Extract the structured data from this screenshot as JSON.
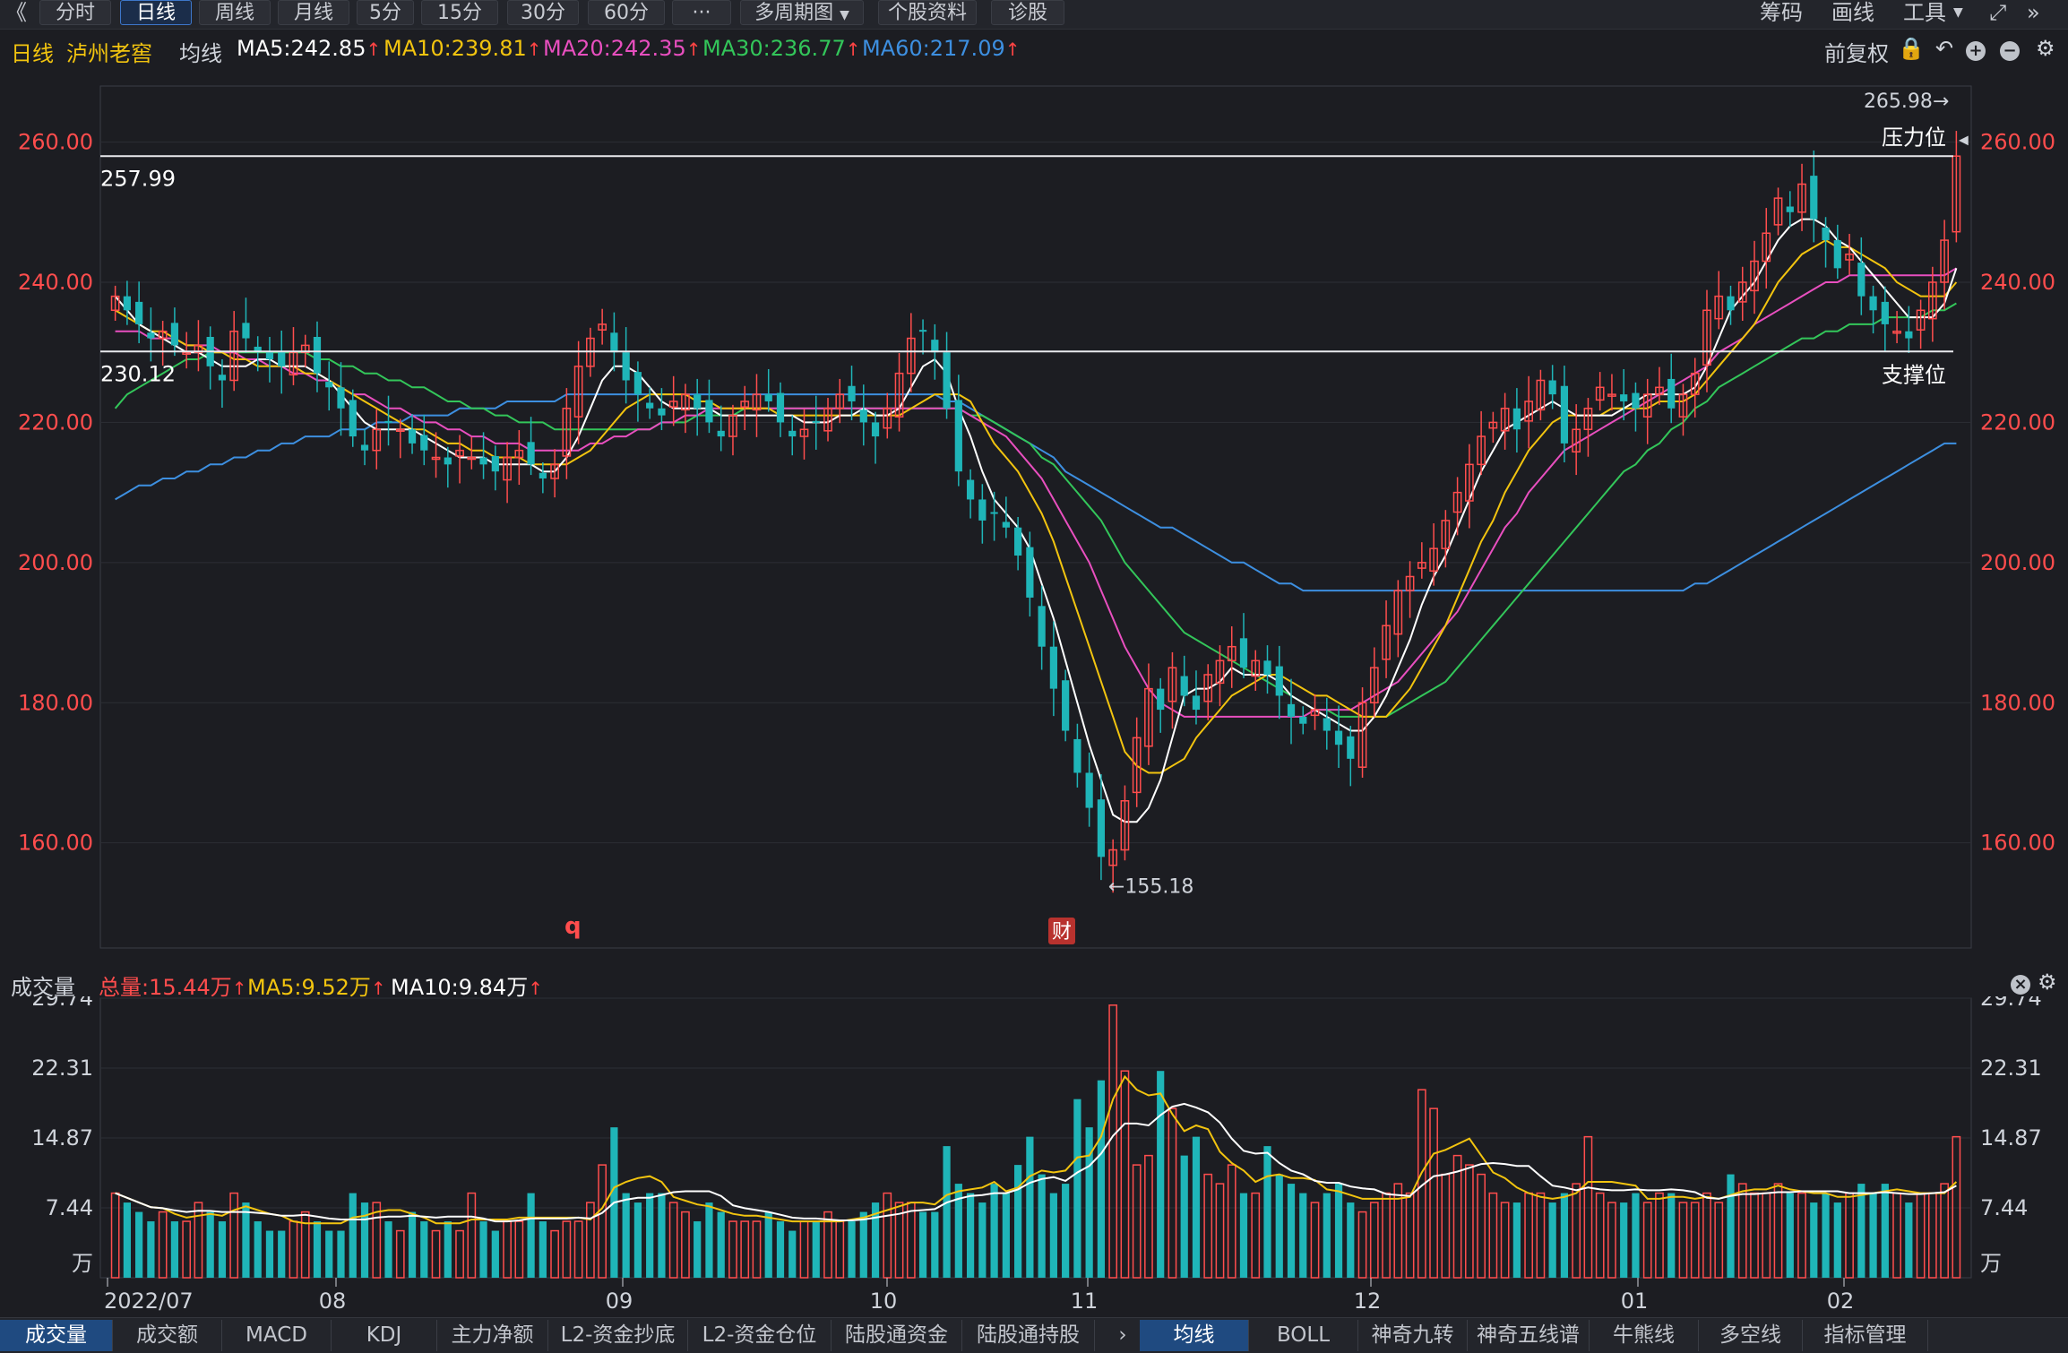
{
  "toolbar": {
    "back_glyph": "《",
    "periods": [
      "分时",
      "日线",
      "周线",
      "月线",
      "5分",
      "15分",
      "30分",
      "60分",
      "···"
    ],
    "active_period": "日线",
    "multi_period": "多周期图",
    "stock_info": "个股资料",
    "diagnose": "诊股",
    "right_items": [
      "筹码",
      "画线",
      "工具"
    ],
    "fullscreen_icon": "fullscreen-icon",
    "collapse_icon": "double-chevron-right-icon"
  },
  "info": {
    "period_label": "日线",
    "stock_name": "泸州老窖",
    "ma_label": "均线",
    "ma5": "MA5:242.85",
    "ma10": "MA10:239.81",
    "ma20": "MA20:242.35",
    "ma30": "MA30:236.77",
    "ma60": "MA60:217.09",
    "adjust": "前复权"
  },
  "price_panel": {
    "ticks": [
      "260.00",
      "240.00",
      "220.00",
      "200.00",
      "180.00",
      "160.00"
    ],
    "resistance_value": "257.99",
    "support_value": "230.12",
    "resistance_label": "压力位",
    "support_label": "支撑位",
    "high_marker": "265.98→",
    "low_marker": "←155.18",
    "q_marker": "q",
    "fin_marker": "财"
  },
  "volume_panel": {
    "label": "成交量",
    "total": "总量:15.44万",
    "ma5": "MA5:9.52万",
    "ma10": "MA10:9.84万",
    "ticks": [
      "29.74",
      "22.31",
      "14.87",
      "7.44"
    ],
    "unit": "万"
  },
  "x_axis": [
    "2022/07",
    "08",
    "09",
    "10",
    "11",
    "12",
    "01",
    "02"
  ],
  "bottom_tabs_left": [
    "成交量",
    "成交额",
    "MACD",
    "KDJ",
    "主力净额",
    "L2-资金抄底",
    "L2-资金仓位",
    "陆股通资金",
    "陆股通持股"
  ],
  "bottom_tabs_right": [
    "均线",
    "BOLL",
    "神奇九转",
    "神奇五线谱",
    "牛熊线",
    "多空线",
    "指标管理"
  ],
  "colors": {
    "up": "#ff4d4d",
    "down": "#1fb5b8",
    "ma5": "#ffffff",
    "ma10": "#f2c40f",
    "ma20": "#e84fbf",
    "ma30": "#33c65a",
    "ma60": "#3d8fe0",
    "bg": "#1c1d22"
  },
  "chart_data": {
    "type": "candlestick",
    "title": "泸州老窖 日线",
    "y_range": [
      145,
      268
    ],
    "resistance": 257.99,
    "support": 230.12,
    "high": 265.98,
    "low": 155.18,
    "close_series": [
      238,
      236,
      234,
      232,
      233,
      231,
      230,
      231,
      228,
      226,
      233,
      232,
      230,
      229,
      228,
      230,
      231,
      227,
      225,
      222,
      218,
      216,
      219,
      220,
      219,
      217,
      216,
      215,
      214,
      216,
      215,
      214,
      213,
      215,
      216,
      214,
      212,
      214,
      222,
      228,
      232,
      234,
      230,
      226,
      224,
      222,
      221,
      223,
      224,
      222,
      220,
      218,
      221,
      223,
      224,
      223,
      220,
      218,
      219,
      220,
      222,
      224,
      223,
      220,
      218,
      222,
      227,
      232,
      233,
      230,
      222,
      213,
      209,
      206,
      207,
      205,
      201,
      195,
      188,
      182,
      176,
      170,
      165,
      158,
      159,
      166,
      175,
      182,
      179,
      185,
      181,
      179,
      184,
      186,
      188,
      185,
      186,
      184,
      181,
      178,
      177,
      179,
      176,
      174,
      172,
      180,
      185,
      191,
      196,
      198,
      200,
      202,
      206,
      210,
      214,
      218,
      220,
      222,
      219,
      223,
      226,
      224,
      217,
      219,
      222,
      225,
      224,
      223,
      222,
      224,
      225,
      222,
      224,
      227,
      236,
      238,
      236,
      240,
      243,
      247,
      252,
      250,
      254,
      249,
      246,
      242,
      244,
      238,
      236,
      234,
      233,
      232,
      236,
      240,
      246,
      258
    ],
    "ma5_series": [
      238,
      236,
      234,
      233,
      232,
      231,
      230,
      230,
      229,
      228,
      228,
      228,
      229,
      229,
      228,
      228,
      228,
      227,
      226,
      224,
      222,
      220,
      219,
      219,
      219,
      219,
      218,
      217,
      216,
      215,
      215,
      215,
      214,
      214,
      214,
      214,
      213,
      213,
      215,
      218,
      222,
      226,
      228,
      228,
      227,
      225,
      223,
      222,
      222,
      222,
      222,
      221,
      221,
      221,
      221,
      221,
      221,
      221,
      220,
      220,
      220,
      221,
      221,
      222,
      221,
      221,
      222,
      225,
      228,
      229,
      227,
      222,
      218,
      213,
      209,
      207,
      205,
      202,
      197,
      192,
      186,
      180,
      174,
      169,
      164,
      163,
      163,
      165,
      169,
      175,
      181,
      182,
      182,
      183,
      185,
      184,
      184,
      184,
      183,
      181,
      180,
      179,
      178,
      177,
      176,
      176,
      178,
      181,
      185,
      189,
      194,
      198,
      201,
      205,
      209,
      213,
      216,
      219,
      220,
      221,
      222,
      223,
      222,
      221,
      221,
      221,
      221,
      222,
      223,
      224,
      224,
      224,
      224,
      225,
      228,
      232,
      236,
      238,
      240,
      243,
      246,
      248,
      249,
      249,
      248,
      246,
      245,
      243,
      241,
      239,
      237,
      235,
      235,
      235,
      237,
      242
    ],
    "ma10_series": [
      236,
      235,
      234,
      233,
      233,
      232,
      231,
      231,
      230,
      230,
      229,
      229,
      228,
      228,
      228,
      228,
      227,
      227,
      226,
      225,
      224,
      223,
      222,
      221,
      220,
      219,
      219,
      218,
      217,
      217,
      216,
      216,
      215,
      215,
      215,
      214,
      214,
      214,
      214,
      215,
      216,
      218,
      220,
      222,
      223,
      224,
      224,
      224,
      224,
      223,
      223,
      222,
      222,
      222,
      222,
      222,
      221,
      221,
      221,
      221,
      221,
      221,
      221,
      221,
      221,
      221,
      221,
      222,
      223,
      224,
      224,
      224,
      223,
      220,
      217,
      215,
      213,
      210,
      207,
      203,
      198,
      193,
      188,
      183,
      178,
      173,
      171,
      170,
      170,
      171,
      172,
      175,
      177,
      179,
      181,
      182,
      183,
      184,
      184,
      183,
      182,
      181,
      181,
      180,
      179,
      178,
      178,
      178,
      180,
      182,
      185,
      188,
      191,
      195,
      199,
      203,
      206,
      210,
      213,
      216,
      218,
      220,
      221,
      221,
      221,
      221,
      222,
      222,
      222,
      222,
      223,
      223,
      223,
      224,
      226,
      228,
      230,
      232,
      234,
      237,
      240,
      242,
      244,
      245,
      246,
      245,
      245,
      244,
      243,
      242,
      240,
      239,
      238,
      238,
      238,
      240
    ],
    "ma20_series": [
      233,
      233,
      233,
      232,
      232,
      232,
      231,
      231,
      231,
      230,
      230,
      229,
      229,
      228,
      228,
      227,
      227,
      226,
      226,
      225,
      224,
      224,
      223,
      222,
      222,
      221,
      220,
      220,
      219,
      219,
      218,
      218,
      217,
      217,
      217,
      216,
      216,
      216,
      216,
      216,
      217,
      217,
      218,
      218,
      219,
      219,
      220,
      220,
      221,
      221,
      222,
      222,
      222,
      222,
      222,
      222,
      222,
      222,
      222,
      222,
      222,
      222,
      222,
      222,
      222,
      222,
      222,
      222,
      222,
      222,
      222,
      222,
      221,
      220,
      219,
      218,
      216,
      214,
      212,
      209,
      206,
      203,
      200,
      196,
      192,
      188,
      185,
      182,
      180,
      179,
      178,
      178,
      178,
      178,
      178,
      178,
      178,
      178,
      178,
      178,
      178,
      179,
      179,
      179,
      179,
      180,
      181,
      182,
      183,
      185,
      187,
      189,
      191,
      193,
      196,
      199,
      202,
      205,
      207,
      210,
      212,
      214,
      216,
      217,
      218,
      219,
      220,
      221,
      222,
      223,
      224,
      225,
      226,
      227,
      228,
      230,
      231,
      232,
      234,
      235,
      236,
      237,
      238,
      239,
      240,
      240,
      241,
      241,
      241,
      241,
      241,
      241,
      241,
      241,
      241,
      242
    ],
    "ma30_series": [
      222,
      224,
      225,
      226,
      227,
      228,
      229,
      229,
      230,
      230,
      230,
      230,
      230,
      230,
      230,
      230,
      230,
      229,
      229,
      228,
      228,
      227,
      227,
      226,
      226,
      225,
      225,
      224,
      223,
      223,
      222,
      222,
      221,
      221,
      220,
      220,
      220,
      219,
      219,
      219,
      219,
      219,
      219,
      219,
      219,
      219,
      220,
      220,
      220,
      221,
      221,
      221,
      221,
      222,
      222,
      222,
      222,
      222,
      222,
      222,
      222,
      222,
      222,
      222,
      222,
      222,
      222,
      222,
      222,
      222,
      222,
      222,
      221,
      221,
      220,
      219,
      218,
      217,
      215,
      214,
      212,
      210,
      208,
      206,
      203,
      200,
      198,
      196,
      194,
      192,
      190,
      189,
      188,
      187,
      186,
      185,
      184,
      183,
      182,
      181,
      180,
      179,
      179,
      178,
      178,
      178,
      178,
      178,
      179,
      180,
      181,
      182,
      183,
      185,
      187,
      189,
      191,
      193,
      195,
      197,
      199,
      201,
      203,
      205,
      207,
      209,
      211,
      213,
      214,
      216,
      217,
      219,
      220,
      222,
      223,
      225,
      226,
      227,
      228,
      229,
      230,
      231,
      232,
      232,
      233,
      233,
      234,
      234,
      234,
      235,
      235,
      235,
      235,
      236,
      236,
      237
    ],
    "ma60_series": [
      209,
      210,
      211,
      211,
      212,
      212,
      213,
      213,
      214,
      214,
      215,
      215,
      216,
      216,
      217,
      217,
      218,
      218,
      218,
      219,
      219,
      219,
      220,
      220,
      220,
      221,
      221,
      221,
      221,
      222,
      222,
      222,
      222,
      223,
      223,
      223,
      223,
      223,
      224,
      224,
      224,
      224,
      224,
      224,
      224,
      224,
      224,
      224,
      224,
      224,
      224,
      224,
      224,
      224,
      224,
      224,
      224,
      224,
      224,
      224,
      224,
      224,
      224,
      224,
      224,
      224,
      224,
      224,
      224,
      224,
      223,
      223,
      222,
      221,
      220,
      219,
      218,
      217,
      216,
      215,
      213,
      212,
      211,
      210,
      209,
      208,
      207,
      206,
      205,
      205,
      204,
      203,
      202,
      201,
      200,
      200,
      199,
      198,
      197,
      197,
      196,
      196,
      196,
      196,
      196,
      196,
      196,
      196,
      196,
      196,
      196,
      196,
      196,
      196,
      196,
      196,
      196,
      196,
      196,
      196,
      196,
      196,
      196,
      196,
      196,
      196,
      196,
      196,
      196,
      196,
      196,
      196,
      196,
      197,
      197,
      198,
      199,
      200,
      201,
      202,
      203,
      204,
      205,
      206,
      207,
      208,
      209,
      210,
      211,
      212,
      213,
      214,
      215,
      216,
      217,
      217
    ],
    "volume_series": [
      9,
      8,
      7,
      6,
      7,
      6,
      6,
      8,
      7,
      6,
      9,
      8,
      6,
      5,
      5,
      6,
      7,
      6,
      5,
      5,
      9,
      8,
      8,
      6,
      5,
      7,
      6,
      5,
      6,
      5,
      9,
      6,
      5,
      6,
      6,
      9,
      6,
      5,
      6,
      6,
      8,
      12,
      16,
      9,
      8,
      9,
      9,
      8,
      7,
      6,
      8,
      7,
      6,
      6,
      6,
      7,
      6,
      5,
      6,
      6,
      7,
      6,
      6,
      7,
      8,
      9,
      8,
      8,
      7,
      7,
      14,
      10,
      9,
      8,
      10,
      9,
      12,
      15,
      11,
      9,
      10,
      19,
      16,
      21,
      29,
      22,
      12,
      13,
      22,
      18,
      13,
      15,
      11,
      10,
      12,
      9,
      9,
      14,
      11,
      10,
      9,
      8,
      9,
      10,
      8,
      7,
      8,
      9,
      10,
      9,
      20,
      18,
      11,
      13,
      12,
      11,
      9,
      8,
      8,
      9,
      9,
      8,
      9,
      10,
      15,
      9,
      8,
      8,
      9,
      8,
      9,
      9,
      8,
      8,
      9,
      8,
      11,
      10,
      9,
      9,
      10,
      9,
      9,
      8,
      9,
      8,
      9,
      10,
      9,
      10,
      9,
      8,
      9,
      9,
      10,
      15
    ],
    "volume_ticks": [
      29.74,
      22.31,
      14.87,
      7.44
    ],
    "volume_unit": "万",
    "x_ticks": [
      "2022/07",
      "08",
      "09",
      "10",
      "11",
      "12",
      "01",
      "02"
    ]
  }
}
